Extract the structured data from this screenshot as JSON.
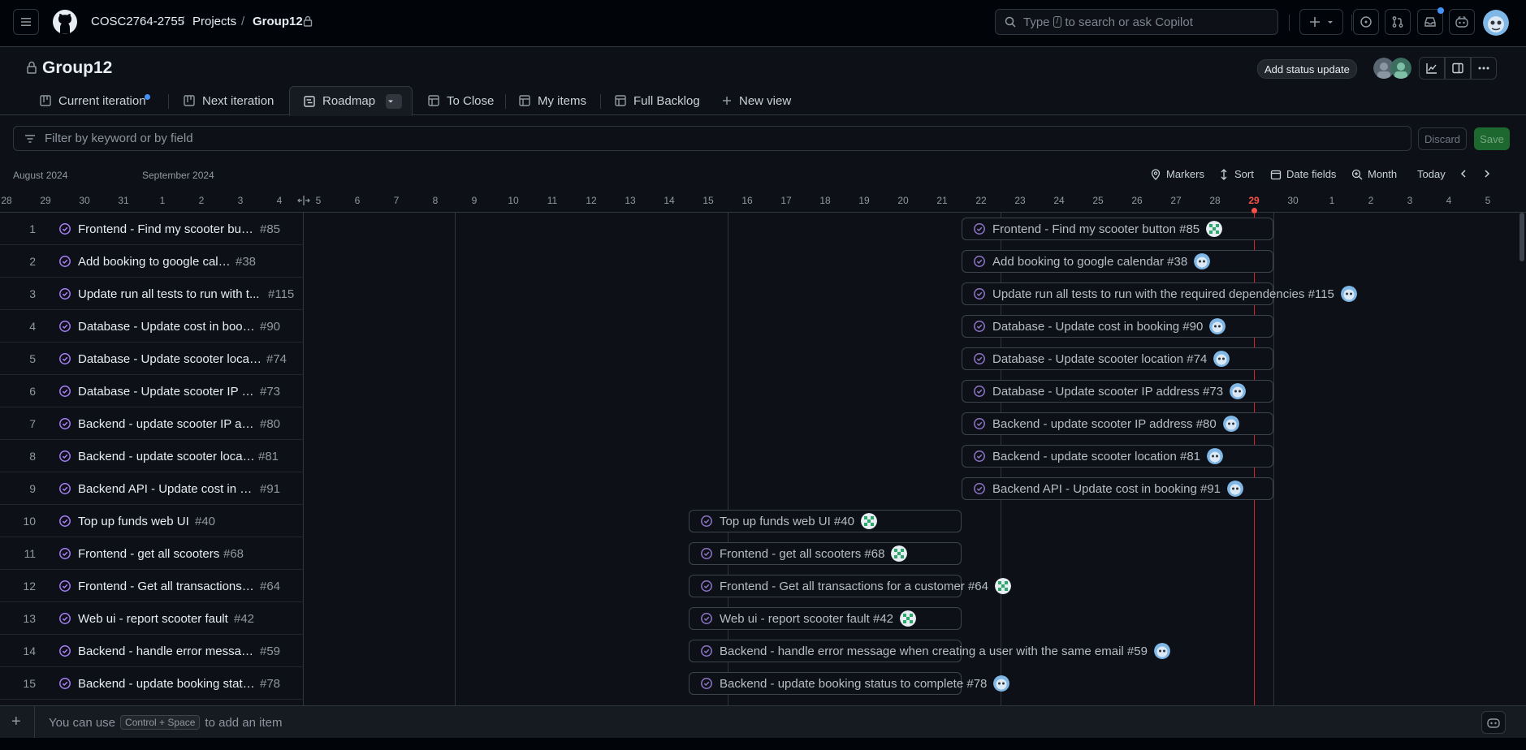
{
  "header": {
    "breadcrumb": [
      "COSC2764-2755",
      "Projects",
      "Group12"
    ],
    "search_placeholder_pre": "Type",
    "search_key": "/",
    "search_placeholder_post": "to search or ask Copilot",
    "icons": [
      "menu-icon",
      "github-logo",
      "lock-icon",
      "search-icon",
      "plus-icon",
      "issues-icon",
      "pull-request-icon",
      "inbox-icon",
      "copilot-icon",
      "user-avatar"
    ]
  },
  "project": {
    "title": "Group12",
    "status_button": "Add status update"
  },
  "tabs": [
    {
      "label": "Current iteration",
      "icon": "board-icon",
      "active": false
    },
    {
      "label": "Next iteration",
      "icon": "board-icon",
      "active": false
    },
    {
      "label": "Roadmap",
      "icon": "roadmap-icon",
      "active": true
    },
    {
      "label": "To Close",
      "icon": "table-icon",
      "active": false
    },
    {
      "label": "My items",
      "icon": "table-icon",
      "active": false
    },
    {
      "label": "Full Backlog",
      "icon": "table-icon",
      "active": false
    },
    {
      "label": "New view",
      "icon": "plus-icon",
      "active": false
    }
  ],
  "filter": {
    "placeholder": "Filter by keyword or by field",
    "discard": "Discard",
    "save": "Save"
  },
  "timeline": {
    "months": [
      "August 2024",
      "September 2024"
    ],
    "controls": {
      "markers": "Markers",
      "sort": "Sort",
      "date_fields": "Date fields",
      "zoom": "Month",
      "today": "Today"
    },
    "days": [
      "28",
      "29",
      "30",
      "31",
      "1",
      "2",
      "3",
      "4",
      "5",
      "6",
      "7",
      "8",
      "9",
      "10",
      "11",
      "12",
      "13",
      "14",
      "15",
      "16",
      "17",
      "18",
      "19",
      "20",
      "21",
      "22",
      "23",
      "24",
      "25",
      "26",
      "27",
      "28",
      "29",
      "30",
      "1",
      "2",
      "3",
      "4",
      "5"
    ],
    "today_label": "29"
  },
  "rows": [
    {
      "n": "1",
      "title": "Frontend - Find my scooter button",
      "num": "#85",
      "bar": "Frontend - Find my scooter button #85"
    },
    {
      "n": "2",
      "title": "Add booking to google calendar",
      "num": "#38",
      "bar": "Add booking to google calendar #38"
    },
    {
      "n": "3",
      "title": "Update run all tests to run with t...",
      "num": "#115",
      "bar": "Update run all tests to run with the required dependencies #115"
    },
    {
      "n": "4",
      "title": "Database - Update cost in booking",
      "num": "#90",
      "bar": "Database - Update cost in booking #90"
    },
    {
      "n": "5",
      "title": "Database - Update scooter location",
      "num": "#74",
      "bar": "Database - Update scooter location #74"
    },
    {
      "n": "6",
      "title": "Database - Update scooter IP add...",
      "num": "#73",
      "bar": "Database - Update scooter IP address #73"
    },
    {
      "n": "7",
      "title": "Backend - update scooter IP addr...",
      "num": "#80",
      "bar": "Backend - update scooter IP address #80"
    },
    {
      "n": "8",
      "title": "Backend - update scooter location",
      "num": "#81",
      "bar": "Backend - update scooter location #81"
    },
    {
      "n": "9",
      "title": "Backend API - Update cost in boo...",
      "num": "#91",
      "bar": "Backend API - Update cost in booking #91"
    },
    {
      "n": "10",
      "title": "Top up funds web UI",
      "num": "#40",
      "bar": "Top up funds web UI #40"
    },
    {
      "n": "11",
      "title": "Frontend - get all scooters",
      "num": "#68",
      "bar": "Frontend - get all scooters #68"
    },
    {
      "n": "12",
      "title": "Frontend - Get all transactions for...",
      "num": "#64",
      "bar": "Frontend - Get all transactions for a customer #64"
    },
    {
      "n": "13",
      "title": "Web ui - report scooter fault",
      "num": "#42",
      "bar": "Web ui - report scooter fault #42"
    },
    {
      "n": "14",
      "title": "Backend - handle error message ...",
      "num": "#59",
      "bar": "Backend - handle error message when creating a user with the same email #59"
    },
    {
      "n": "15",
      "title": "Backend - update booking status ...",
      "num": "#78",
      "bar": "Backend - update booking status to complete #78"
    }
  ],
  "bottom": {
    "hint_pre": "You can use",
    "hint_key": "Control + Space",
    "hint_post": "to add an item"
  }
}
